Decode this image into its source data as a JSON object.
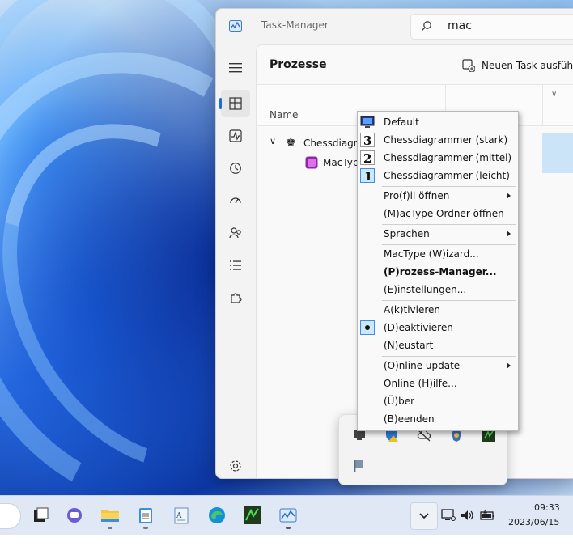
{
  "window": {
    "title": "Task-Manager",
    "search_value": "mac",
    "page_title": "Prozesse",
    "new_task_label": "Neuen Task ausführen"
  },
  "table": {
    "name_header": "Name",
    "rows": [
      {
        "name": "Chessdiagrammer"
      },
      {
        "name": "MacType"
      }
    ]
  },
  "context_menu": {
    "items": [
      {
        "label": "Default",
        "icon": "monitor-icon"
      },
      {
        "label": "Chessdiagrammer (stark)",
        "icon": "chess-3-icon"
      },
      {
        "label": "Chessdiagrammer (mittel)",
        "icon": "chess-2-icon"
      },
      {
        "label": "Chessdiagrammer (leicht)",
        "icon": "chess-1-icon",
        "selected": true
      },
      {
        "label": "Pro(f)il öffnen",
        "submenu": true
      },
      {
        "label": "(M)acType Ordner öffnen"
      },
      {
        "label": "Sprachen",
        "submenu": true
      },
      {
        "label": "MacType (W)izard..."
      },
      {
        "label": "(P)rozess-Manager...",
        "bold": true
      },
      {
        "label": "(E)instellungen..."
      },
      {
        "label": "A(k)tivieren"
      },
      {
        "label": "(D)eaktivieren",
        "checked": true
      },
      {
        "label": "(N)eustart"
      },
      {
        "label": "(O)nline update",
        "submenu": true
      },
      {
        "label": "Online (H)ilfe..."
      },
      {
        "label": "(Ü)ber"
      },
      {
        "label": "(B)eenden"
      }
    ]
  },
  "taskbar": {
    "time": "09:33",
    "date": "2023/06/15"
  },
  "colors": {
    "accent": "#1c6fd0",
    "selected_row": "#cce4f7"
  }
}
